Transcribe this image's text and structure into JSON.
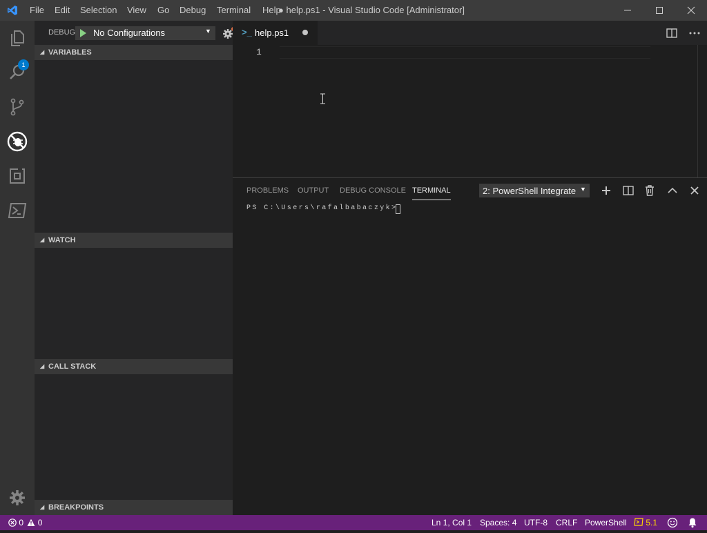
{
  "menu": [
    "File",
    "Edit",
    "Selection",
    "View",
    "Go",
    "Debug",
    "Terminal",
    "Help"
  ],
  "window_title": "● help.ps1 - Visual Studio Code [Administrator]",
  "activity": {
    "badge": "1"
  },
  "debug": {
    "label": "DEBUG",
    "config": "No Configurations"
  },
  "sidebar": {
    "variables": "VARIABLES",
    "watch": "WATCH",
    "call_stack": "CALL STACK",
    "breakpoints": "BREAKPOINTS"
  },
  "editor": {
    "tab": "help.ps1",
    "line_number": "1"
  },
  "panel": {
    "tabs": [
      "PROBLEMS",
      "OUTPUT",
      "DEBUG CONSOLE",
      "TERMINAL"
    ],
    "active_tab": "TERMINAL",
    "terminal_select": "2: PowerShell Integrate",
    "prompt": "PS C:\\Users\\rafalbabaczyk> "
  },
  "status": {
    "errors": "0",
    "warnings": "0",
    "position": "Ln 1, Col 1",
    "spaces": "Spaces: 4",
    "encoding": "UTF-8",
    "eol": "CRLF",
    "language": "PowerShell",
    "ps_version": "5.1"
  },
  "colors": {
    "statusbar": "#68217a",
    "accent": "#007acc",
    "debug_green": "#89d185"
  }
}
